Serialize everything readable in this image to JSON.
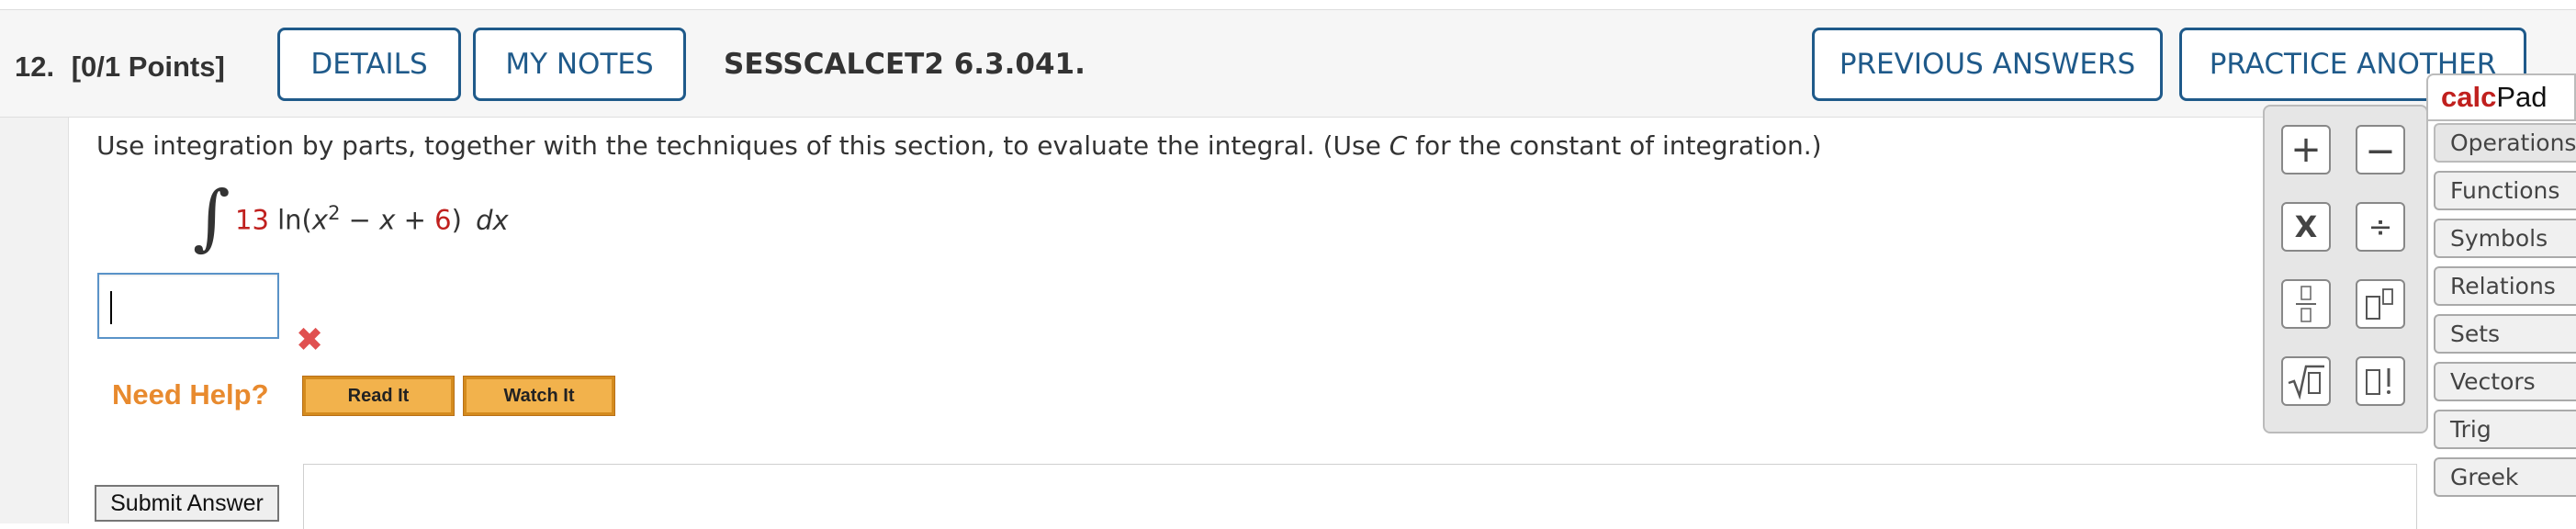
{
  "header": {
    "question_number": "12.",
    "points": "[0/1 Points]",
    "details_label": "DETAILS",
    "my_notes_label": "MY NOTES",
    "question_id": "SESSCALCET2 6.3.041.",
    "previous_answers_label": "PREVIOUS ANSWERS",
    "practice_another_label": "PRACTICE ANOTHER"
  },
  "question": {
    "instruction_before": "Use integration by parts, together with the techniques of this section, to evaluate the integral. (Use ",
    "instruction_var": "C",
    "instruction_after": " for the constant of integration.)",
    "integral_sign": "∫",
    "coefficient": "13",
    "func": "ln(",
    "var_x": "x",
    "exponent": "2",
    "minus": " − ",
    "var_x2": "x",
    "plus": " + ",
    "constant": "6",
    "close": ")",
    "dx": "dx"
  },
  "answer": {
    "value": "",
    "status_icon": "✖"
  },
  "help": {
    "label": "Need Help?",
    "read_it": "Read It",
    "watch_it": "Watch It"
  },
  "submit_label": "Submit Answer",
  "calcpad": {
    "title_part1": "calc",
    "title_part2": "Pad",
    "buttons": {
      "plus": "+",
      "minus": "—",
      "times": "X",
      "divide": "÷",
      "fraction": "▯/▯",
      "power": "▯▯",
      "sqrt": "√▯",
      "factorial": "▯!"
    },
    "tabs": [
      "Operations",
      "Functions",
      "Symbols",
      "Relations",
      "Sets",
      "Vectors",
      "Trig",
      "Greek"
    ]
  }
}
